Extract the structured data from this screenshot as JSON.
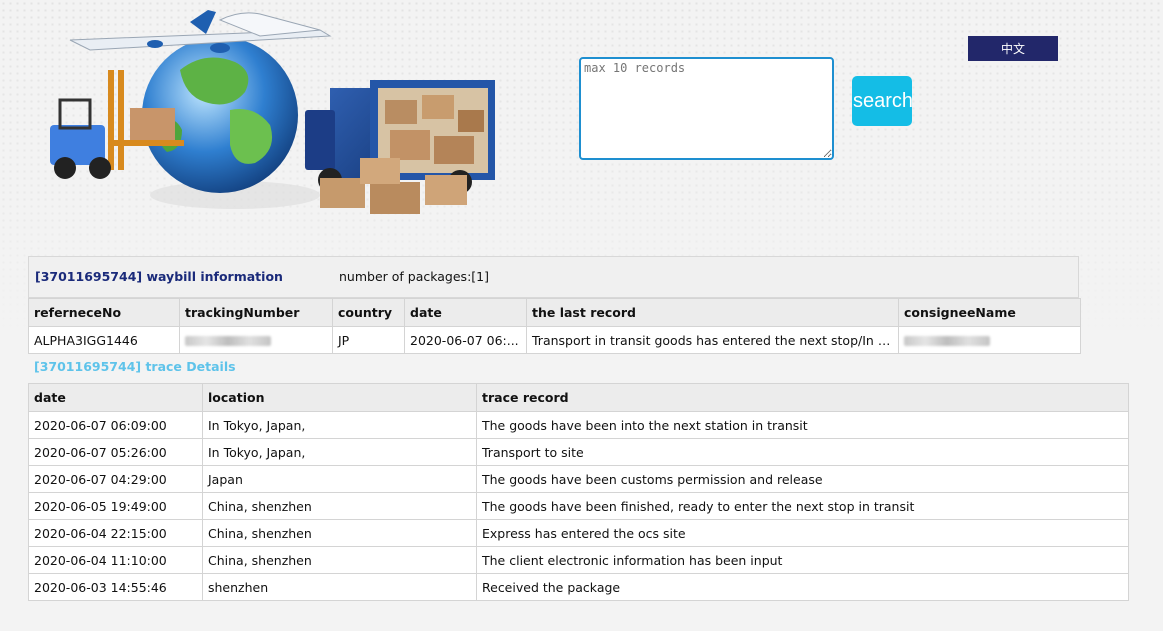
{
  "search": {
    "placeholder": "max 10 records",
    "button_label": "search"
  },
  "language_button": "中文",
  "waybill": {
    "title": "[37011695744] waybill information",
    "packages_label": "number of packages:[1]",
    "headers": [
      "referneceNo",
      "trackingNumber",
      "country",
      "date",
      "the last record",
      "consigneeName"
    ],
    "row": {
      "referenceNo": "ALPHA3IGG1446",
      "country": "JP",
      "date": "2020-06-07 06:...",
      "last_record": "Transport in transit goods has entered the next stop/In T..."
    }
  },
  "trace": {
    "title": "[37011695744] trace Details",
    "headers": [
      "date",
      "location",
      "trace record"
    ],
    "rows": [
      {
        "date": "2020-06-07 06:09:00",
        "location": "In Tokyo, Japan,",
        "record": "The goods have been into the next station in transit"
      },
      {
        "date": "2020-06-07 05:26:00",
        "location": "In Tokyo, Japan,",
        "record": "Transport to site"
      },
      {
        "date": "2020-06-07 04:29:00",
        "location": "Japan",
        "record": "The goods have been customs permission and release"
      },
      {
        "date": "2020-06-05 19:49:00",
        "location": "China, shenzhen",
        "record": "The goods have been finished, ready to enter the next stop in transit"
      },
      {
        "date": "2020-06-04 22:15:00",
        "location": "China, shenzhen",
        "record": "Express has entered the ocs site"
      },
      {
        "date": "2020-06-04 11:10:00",
        "location": "China, shenzhen",
        "record": "The client electronic information has been input"
      },
      {
        "date": "2020-06-03 14:55:46",
        "location": "shenzhen",
        "record": "Received the package"
      }
    ]
  },
  "colors": {
    "accent_blue": "#14bde6",
    "textarea_border": "#1e8fd0",
    "lang_button_bg": "#22276a",
    "waybill_title": "#1a2a7a",
    "trace_title": "#5ec3ea"
  }
}
